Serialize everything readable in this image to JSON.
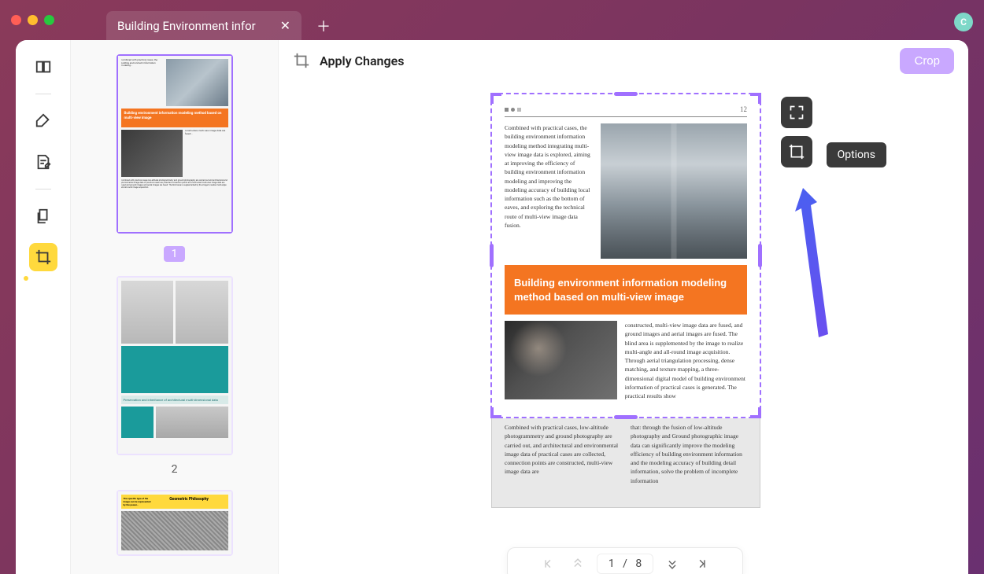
{
  "colors": {
    "accent": "#a070ff",
    "action_yellow": "#ffd93d",
    "crop_purple": "#c9a8ff",
    "orange": "#f47521",
    "tooltip_bg": "#3a3a3a"
  },
  "window": {
    "tab_title": "Building Environment infor",
    "avatar_letter": "C"
  },
  "toolbar": {
    "apply_label": "Apply Changes",
    "crop_label": "Crop"
  },
  "right_tools": {
    "options_tooltip": "Options"
  },
  "page_nav": {
    "current": "1",
    "separator": "/",
    "total": "8"
  },
  "thumbnails": {
    "page1_num": "1",
    "page2_num": "2",
    "page1_orange": "Building environment information modeling method based on multi-view image",
    "page2_label": "Preservation and inheritance of architectural multi-dimensional data",
    "page3_title": "Geometric Philosophy"
  },
  "document": {
    "page_number": "12",
    "paragraph_a": "Combined with practical cases, the building environment information modeling method integrating multi-view image data is explored, aiming at improving the efficiency of building environment information modeling and improving the modeling accuracy of building local information such as the bottom of eaves, and exploring the technical route of multi-view image data fusion.",
    "orange_title": "Building environment information modeling method based on multi-view image",
    "paragraph_b": "constructed, multi-view image data are fused, and ground images and aerial images are fused. The blind area is supplemented by the image to realize multi-angle and all-round image acquisition. Through aerial triangulation processing, dense matching, and texture mapping, a three-dimensional digital model of building environment information of practical cases is generated. The practical results show",
    "paragraph_c_left": "Combined with practical cases, low-altitude photogrammetry and ground photography are carried out, and architectural and environmental image data of practical cases are collected, connection points are constructed, multi-view image data are",
    "paragraph_c_right": "that: through the fusion of low-altitude photography and Ground photographic image data can significantly improve the modeling efficiency of building environment information and the modeling accuracy of building detail information, solve the problem of incomplete information"
  }
}
